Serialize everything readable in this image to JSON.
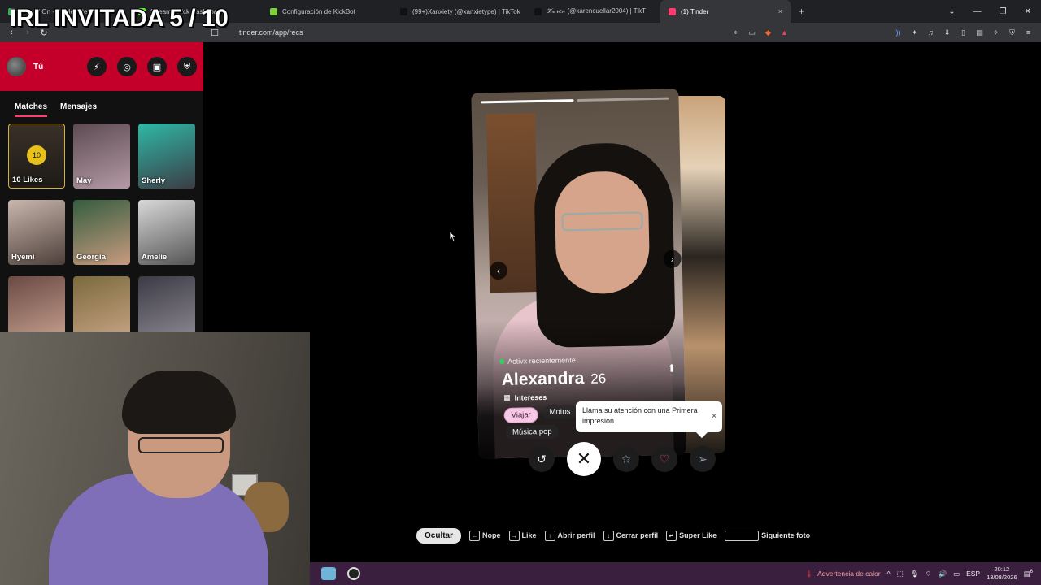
{
  "overlay_title": "IRL INVITADA 5 / 10",
  "browser": {
    "tabs": [
      {
        "label": "Holdin' On - Skrillex Remix - Be",
        "color": "#2bb24c",
        "active": false
      },
      {
        "label": "Stream - Kick Dashboard",
        "color": "#53fc18",
        "active": false
      },
      {
        "label": "Configuración de KickBot",
        "color": "#7fd13b",
        "active": false
      },
      {
        "label": "(99+)Xanxiety (@xanxietype) | TikTok",
        "color": "#111111",
        "active": false
      },
      {
        "label": "𝒦𝒶𝓇𝑒𝓃 (@karencuellar2004) | TikT",
        "color": "#111111",
        "active": false
      },
      {
        "label": "(1) Tinder",
        "color": "#fe3c72",
        "active": true
      }
    ],
    "tab_close": "×",
    "new_tab": "+",
    "window_controls": [
      "⌄",
      "—",
      "❐",
      "✕"
    ],
    "url": "tinder.com/app/recs"
  },
  "sidebar": {
    "user_name": "Tú",
    "header_icons": [
      {
        "name": "boost-icon",
        "glyph": "⚡"
      },
      {
        "name": "explore-icon",
        "glyph": "◎"
      },
      {
        "name": "briefcase-icon",
        "glyph": "▣"
      },
      {
        "name": "shield-icon",
        "glyph": "⛨"
      }
    ],
    "tabs": [
      {
        "label": "Matches",
        "active": true
      },
      {
        "label": "Mensajes",
        "active": false
      }
    ],
    "likes_count": "10",
    "likes_label": "10 Likes",
    "matches": [
      {
        "name": "May",
        "colors": [
          "#5c4b52",
          "#b59aa6"
        ]
      },
      {
        "name": "Sherly",
        "colors": [
          "#2fb8a7",
          "#3b3c45"
        ]
      },
      {
        "name": "Hyemi",
        "colors": [
          "#c9b7ad",
          "#4d3f3a"
        ]
      },
      {
        "name": "Georgia",
        "colors": [
          "#355d3f",
          "#c89b80"
        ]
      },
      {
        "name": "Amelie",
        "colors": [
          "#d8d8d8",
          "#555555"
        ]
      },
      {
        "name": "",
        "colors": [
          "#6a4a44",
          "#c7a08f"
        ]
      },
      {
        "name": "",
        "colors": [
          "#7b6a3d",
          "#c9a486"
        ]
      },
      {
        "name": "",
        "colors": [
          "#3c3a44",
          "#8d8a94"
        ]
      }
    ]
  },
  "profile": {
    "status": "Activx recientemente",
    "name": "Alexandra",
    "age": "26",
    "interests_label": "Intereses",
    "interests": [
      "Viajar",
      "Motos",
      "Música pop"
    ],
    "photo_count": 2,
    "active_photo": 0
  },
  "tooltip": {
    "text": "Llama su atención con una Primera impresión",
    "close": "×"
  },
  "actions": {
    "rewind": "↺",
    "nope": "✕",
    "super_like": "☆",
    "like": "♡",
    "send": "➢"
  },
  "shortcuts": {
    "hide_label": "Ocultar",
    "items": [
      {
        "key": "←",
        "label": "Nope"
      },
      {
        "key": "→",
        "label": "Like"
      },
      {
        "key": "↑",
        "label": "Abrir perfil"
      },
      {
        "key": "↓",
        "label": "Cerrar perfil"
      },
      {
        "key": "↵",
        "label": "Super Like"
      },
      {
        "key": "",
        "label": "Siguiente foto",
        "wide": true
      }
    ]
  },
  "taskbar": {
    "warning": "Advertencia de calor",
    "lang": "ESP",
    "time": "20:12",
    "date": "13/08/2026",
    "notif": "6"
  },
  "colors": {
    "accent": "#fe3c72",
    "header_red": "#c4002a",
    "taskbar": "#3a1f3e"
  }
}
